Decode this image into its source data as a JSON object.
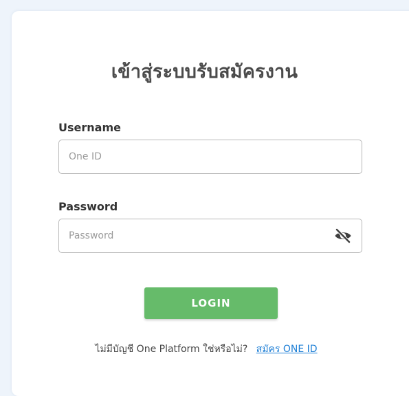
{
  "login": {
    "title": "เข้าสู่ระบบรับสมัครงาน",
    "username_label": "Username",
    "username_placeholder": "One ID",
    "password_label": "Password",
    "password_placeholder": "Password",
    "password_toggle_icon": "eye-slash-icon",
    "button_label": "LOGIN",
    "button_color": "#66bb6a",
    "footer_text": "ไม่มีบัญชี One Platform ใช่หรือไม่?",
    "signup_link": "สมัคร ONE ID",
    "link_color": "#1e7fd6"
  }
}
